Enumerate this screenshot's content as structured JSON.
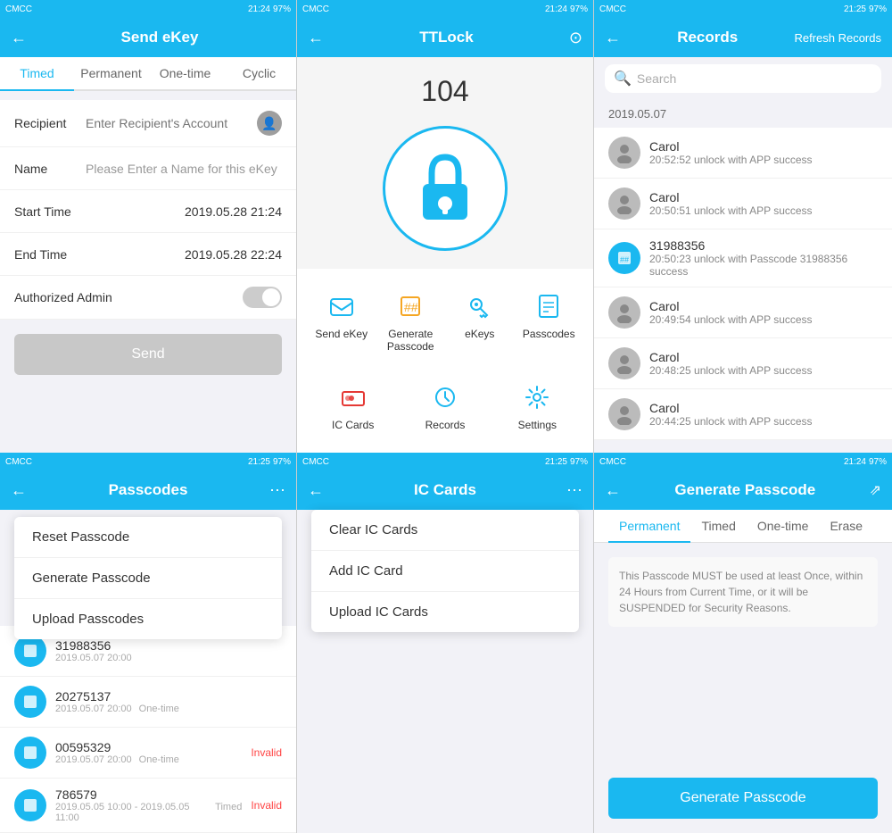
{
  "topRow": {
    "screen1": {
      "statusBar": {
        "time": "21:24",
        "carrier": "CMCC",
        "wifi": "WiFi",
        "battery": "97%"
      },
      "header": {
        "title": "Send eKey",
        "backLabel": "←"
      },
      "tabs": [
        {
          "label": "Timed",
          "active": true
        },
        {
          "label": "Permanent",
          "active": false
        },
        {
          "label": "One-time",
          "active": false
        },
        {
          "label": "Cyclic",
          "active": false
        }
      ],
      "form": {
        "recipientLabel": "Recipient",
        "recipientPlaceholder": "Enter Recipient's Account",
        "nameLabel": "Name",
        "namePlaceholder": "Please Enter a Name for this eKey",
        "startTimeLabel": "Start Time",
        "startTimeValue": "2019.05.28 21:24",
        "endTimeLabel": "End Time",
        "endTimeValue": "2019.05.28 22:24",
        "authorizedAdminLabel": "Authorized Admin"
      },
      "sendButton": "Send"
    },
    "screen2": {
      "statusBar": {
        "time": "21:24",
        "carrier": "CMCC",
        "wifi": "WiFi",
        "battery": "97%"
      },
      "header": {
        "title": "TTLock"
      },
      "lockNumber": "104",
      "menuItems": [
        {
          "label": "Send eKey",
          "icon": "send-ekey"
        },
        {
          "label": "Generate Passcode",
          "icon": "passcode"
        },
        {
          "label": "eKeys",
          "icon": "ekeys"
        },
        {
          "label": "Passcodes",
          "icon": "passcodes"
        },
        {
          "label": "IC Cards",
          "icon": "ic-cards"
        },
        {
          "label": "Records",
          "icon": "records"
        },
        {
          "label": "Settings",
          "icon": "settings"
        }
      ]
    },
    "screen3": {
      "statusBar": {
        "time": "21:25",
        "carrier": "CMCC",
        "wifi": "WiFi",
        "battery": "97%"
      },
      "header": {
        "title": "Records",
        "refreshLabel": "Refresh Records"
      },
      "searchPlaceholder": "Search",
      "dateGroup": "2019.05.07",
      "records": [
        {
          "name": "Carol",
          "detail": "20:52:52 unlock with APP success"
        },
        {
          "name": "Carol",
          "detail": "20:50:51 unlock with APP success"
        },
        {
          "name": "31988356",
          "detail": "20:50:23 unlock with Passcode 31988356 success",
          "isPasscode": true
        },
        {
          "name": "Carol",
          "detail": "20:49:54 unlock with APP success"
        },
        {
          "name": "Carol",
          "detail": "20:48:25 unlock with APP success"
        },
        {
          "name": "Carol",
          "detail": "20:44:25 unlock with APP success"
        }
      ]
    }
  },
  "bottomRow": {
    "screen1": {
      "statusBar": {
        "time": "21:25",
        "carrier": "CMCC"
      },
      "header": {
        "title": "Passcodes",
        "backLabel": "←"
      },
      "dropdown": {
        "items": [
          "Reset Passcode",
          "Generate Passcode",
          "Upload Passcodes"
        ]
      },
      "passcodes": [
        {
          "code": "31988356",
          "date": "2019.05.07 20:00",
          "type": "",
          "status": ""
        },
        {
          "code": "20275137",
          "date": "2019.05.07 20:00",
          "type": "One-time",
          "status": ""
        },
        {
          "code": "00595329",
          "date": "2019.05.07 20:00",
          "type": "One-time",
          "status": "Invalid"
        },
        {
          "code": "786579",
          "date": "2019.05.05 10:00 - 2019.05.05 11:00",
          "type": "Timed",
          "status": "Invalid"
        }
      ]
    },
    "screen2": {
      "statusBar": {
        "time": "21:25",
        "carrier": "CMCC"
      },
      "header": {
        "title": "IC Cards",
        "backLabel": "←"
      },
      "dropdown": {
        "items": [
          "Clear IC Cards",
          "Add IC Card",
          "Upload IC Cards"
        ]
      }
    },
    "screen3": {
      "statusBar": {
        "time": "21:24",
        "carrier": "CMCC"
      },
      "header": {
        "title": "Generate Passcode",
        "backLabel": "←"
      },
      "tabs": [
        {
          "label": "Permanent",
          "active": true
        },
        {
          "label": "Timed",
          "active": false
        },
        {
          "label": "One-time",
          "active": false
        },
        {
          "label": "Erase",
          "active": false
        }
      ],
      "note": "This Passcode MUST be used at least Once, within 24 Hours from Current Time, or it will be SUSPENDED for Security Reasons.",
      "generateButton": "Generate Passcode"
    }
  }
}
